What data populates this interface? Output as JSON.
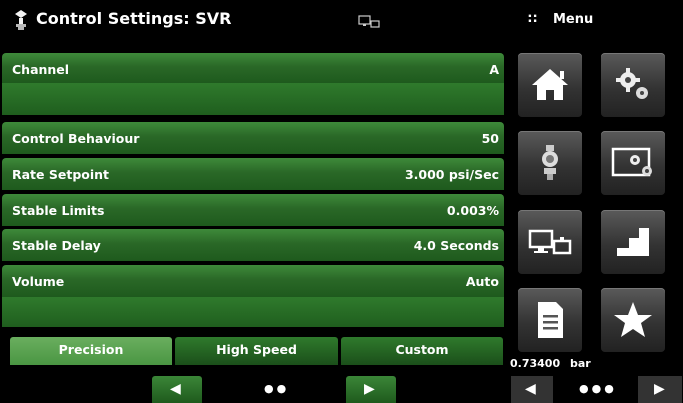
{
  "header": {
    "title": "Control Settings: SVR",
    "menu_label": "Menu",
    "menu_glyph": "∷"
  },
  "rows": [
    {
      "label": "Channel",
      "value": "A"
    },
    {
      "label": "Control Behaviour",
      "value": "50"
    },
    {
      "label": "Rate Setpoint",
      "value": "3.000 psi/Sec"
    },
    {
      "label": "Stable Limits",
      "value": "0.003%"
    },
    {
      "label": "Stable Delay",
      "value": "4.0 Seconds"
    },
    {
      "label": "Volume",
      "value": "Auto"
    }
  ],
  "tabs": [
    {
      "label": "Precision",
      "active": true
    },
    {
      "label": "High Speed",
      "active": false
    },
    {
      "label": "Custom",
      "active": false
    }
  ],
  "pager": {
    "dots": "●●",
    "prev_icon": "◀",
    "next_icon": "▶"
  },
  "menu": {
    "tiles": [
      "home-icon",
      "gears-icon",
      "sensor-icon",
      "monitor-gear-icon",
      "remote-icon",
      "step-icon",
      "document-icon",
      "star-icon"
    ],
    "readout_value": "0.73400",
    "readout_unit": "bar",
    "dots": "●●●",
    "prev_icon": "◀",
    "next_icon": "▶"
  },
  "colors": {
    "accent_green": "#2a6827",
    "active_tab": "#5ea455",
    "tile": "#3a3a3a"
  }
}
